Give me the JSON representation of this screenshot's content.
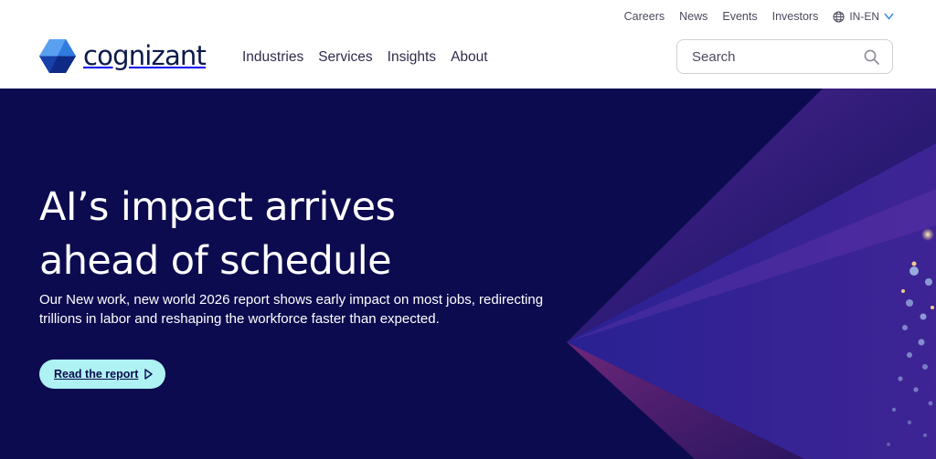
{
  "colors": {
    "brand_navy": "#0b1a4b",
    "hero_bg": "#0c0b4f",
    "cta_bg": "#aef2f4",
    "accent_blue": "#3f8ee8"
  },
  "utility_nav": {
    "links": [
      "Careers",
      "News",
      "Events",
      "Investors"
    ],
    "locale": "IN-EN",
    "locale_icon": "globe-icon"
  },
  "brand": {
    "name": "cognizant",
    "logo_icon": "cognizant-hexagon-logo"
  },
  "main_nav": {
    "items": [
      "Industries",
      "Services",
      "Insights",
      "About"
    ]
  },
  "search": {
    "placeholder": "Search",
    "icon": "search-icon"
  },
  "hero": {
    "title_line1": "AI’s impact arrives",
    "title_line2": "ahead of schedule",
    "subtitle": "Our New work, new world 2026 report shows early impact on most jobs, redirecting trillions in labor and reshaping the workforce faster than expected.",
    "cta_label": "Read the report",
    "cta_icon": "play-outline-icon"
  }
}
